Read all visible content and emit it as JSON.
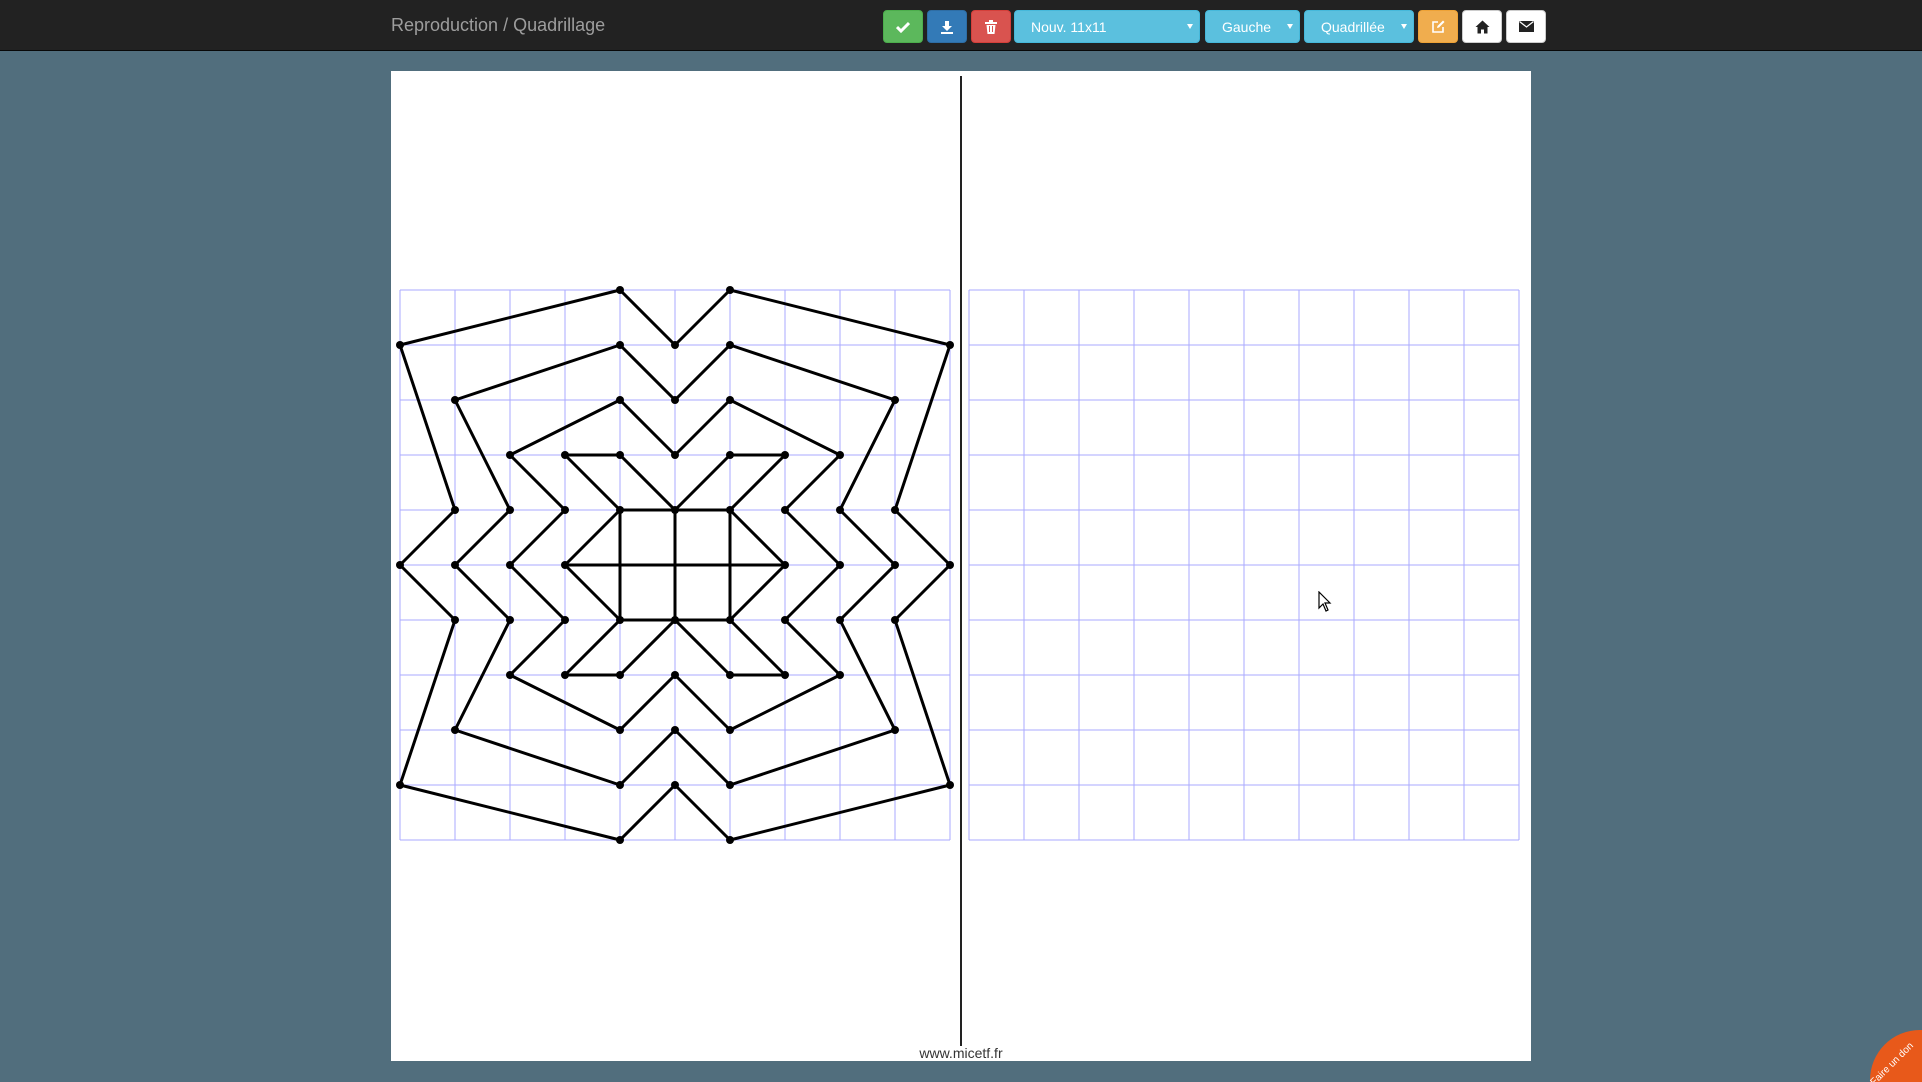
{
  "header": {
    "title": "Reproduction / Quadrillage",
    "buttons": {
      "validate_icon": "check-icon",
      "download_icon": "download-icon",
      "delete_icon": "trash-icon",
      "edit_icon": "edit-icon",
      "home_icon": "home-icon",
      "mail_icon": "envelope-icon"
    },
    "dropdowns": {
      "model": "Nouv. 11x11",
      "side": "Gauche",
      "paper": "Quadrillée"
    },
    "colors": {
      "green": "#5cb85c",
      "blue": "#337ab7",
      "red": "#d9534f",
      "info": "#5bc0de",
      "orange": "#f0ad4e",
      "white": "#ffffff"
    }
  },
  "workspace": {
    "grid_size": 11,
    "grid_color": "#aaaaff",
    "model_figure": {
      "segments": [
        [
          [
            0,
            1
          ],
          [
            4,
            0
          ]
        ],
        [
          [
            4,
            0
          ],
          [
            5,
            1
          ]
        ],
        [
          [
            5,
            1
          ],
          [
            6,
            0
          ]
        ],
        [
          [
            6,
            0
          ],
          [
            10,
            1
          ]
        ],
        [
          [
            0,
            1
          ],
          [
            1,
            4
          ]
        ],
        [
          [
            10,
            1
          ],
          [
            9,
            4
          ]
        ],
        [
          [
            1,
            4
          ],
          [
            0,
            5
          ]
        ],
        [
          [
            0,
            5
          ],
          [
            1,
            6
          ]
        ],
        [
          [
            9,
            4
          ],
          [
            10,
            5
          ]
        ],
        [
          [
            10,
            5
          ],
          [
            9,
            6
          ]
        ],
        [
          [
            1,
            6
          ],
          [
            0,
            9
          ]
        ],
        [
          [
            9,
            6
          ],
          [
            10,
            9
          ]
        ],
        [
          [
            0,
            9
          ],
          [
            4,
            10
          ]
        ],
        [
          [
            4,
            10
          ],
          [
            5,
            9
          ]
        ],
        [
          [
            5,
            9
          ],
          [
            6,
            10
          ]
        ],
        [
          [
            6,
            10
          ],
          [
            10,
            9
          ]
        ],
        [
          [
            1,
            2
          ],
          [
            4,
            1
          ]
        ],
        [
          [
            4,
            1
          ],
          [
            5,
            2
          ]
        ],
        [
          [
            5,
            2
          ],
          [
            6,
            1
          ]
        ],
        [
          [
            6,
            1
          ],
          [
            9,
            2
          ]
        ],
        [
          [
            1,
            2
          ],
          [
            2,
            4
          ]
        ],
        [
          [
            9,
            2
          ],
          [
            8,
            4
          ]
        ],
        [
          [
            2,
            4
          ],
          [
            1,
            5
          ]
        ],
        [
          [
            1,
            5
          ],
          [
            2,
            6
          ]
        ],
        [
          [
            8,
            4
          ],
          [
            9,
            5
          ]
        ],
        [
          [
            9,
            5
          ],
          [
            8,
            6
          ]
        ],
        [
          [
            2,
            6
          ],
          [
            1,
            8
          ]
        ],
        [
          [
            8,
            6
          ],
          [
            9,
            8
          ]
        ],
        [
          [
            1,
            8
          ],
          [
            4,
            9
          ]
        ],
        [
          [
            4,
            9
          ],
          [
            5,
            8
          ]
        ],
        [
          [
            5,
            8
          ],
          [
            6,
            9
          ]
        ],
        [
          [
            6,
            9
          ],
          [
            9,
            8
          ]
        ],
        [
          [
            2,
            3
          ],
          [
            4,
            2
          ]
        ],
        [
          [
            4,
            2
          ],
          [
            5,
            3
          ]
        ],
        [
          [
            5,
            3
          ],
          [
            6,
            2
          ]
        ],
        [
          [
            6,
            2
          ],
          [
            8,
            3
          ]
        ],
        [
          [
            2,
            3
          ],
          [
            3,
            4
          ]
        ],
        [
          [
            3,
            4
          ],
          [
            2,
            5
          ]
        ],
        [
          [
            2,
            5
          ],
          [
            3,
            6
          ]
        ],
        [
          [
            3,
            6
          ],
          [
            2,
            7
          ]
        ],
        [
          [
            8,
            3
          ],
          [
            7,
            4
          ]
        ],
        [
          [
            7,
            4
          ],
          [
            8,
            5
          ]
        ],
        [
          [
            8,
            5
          ],
          [
            7,
            6
          ]
        ],
        [
          [
            7,
            6
          ],
          [
            8,
            7
          ]
        ],
        [
          [
            2,
            7
          ],
          [
            4,
            8
          ]
        ],
        [
          [
            4,
            8
          ],
          [
            5,
            7
          ]
        ],
        [
          [
            5,
            7
          ],
          [
            6,
            8
          ]
        ],
        [
          [
            6,
            8
          ],
          [
            8,
            7
          ]
        ],
        [
          [
            3,
            3
          ],
          [
            4,
            3
          ]
        ],
        [
          [
            6,
            3
          ],
          [
            7,
            3
          ]
        ],
        [
          [
            3,
            7
          ],
          [
            4,
            7
          ]
        ],
        [
          [
            6,
            7
          ],
          [
            7,
            7
          ]
        ],
        [
          [
            3,
            3
          ],
          [
            4,
            4
          ]
        ],
        [
          [
            4,
            3
          ],
          [
            5,
            4
          ]
        ],
        [
          [
            5,
            4
          ],
          [
            6,
            3
          ]
        ],
        [
          [
            7,
            3
          ],
          [
            6,
            4
          ]
        ],
        [
          [
            3,
            7
          ],
          [
            4,
            6
          ]
        ],
        [
          [
            4,
            7
          ],
          [
            5,
            6
          ]
        ],
        [
          [
            5,
            6
          ],
          [
            6,
            7
          ]
        ],
        [
          [
            7,
            7
          ],
          [
            6,
            6
          ]
        ],
        [
          [
            3,
            5
          ],
          [
            4,
            4
          ]
        ],
        [
          [
            3,
            5
          ],
          [
            4,
            6
          ]
        ],
        [
          [
            7,
            5
          ],
          [
            6,
            4
          ]
        ],
        [
          [
            7,
            5
          ],
          [
            6,
            6
          ]
        ],
        [
          [
            3,
            5
          ],
          [
            7,
            5
          ]
        ],
        [
          [
            4,
            4
          ],
          [
            6,
            4
          ]
        ],
        [
          [
            4,
            6
          ],
          [
            6,
            6
          ]
        ],
        [
          [
            4,
            4
          ],
          [
            4,
            6
          ]
        ],
        [
          [
            5,
            4
          ],
          [
            5,
            6
          ]
        ],
        [
          [
            6,
            4
          ],
          [
            6,
            6
          ]
        ]
      ],
      "points": [
        [
          4,
          0
        ],
        [
          6,
          0
        ],
        [
          0,
          1
        ],
        [
          4,
          1
        ],
        [
          5,
          1
        ],
        [
          6,
          1
        ],
        [
          10,
          1
        ],
        [
          1,
          2
        ],
        [
          4,
          2
        ],
        [
          5,
          2
        ],
        [
          6,
          2
        ],
        [
          9,
          2
        ],
        [
          2,
          3
        ],
        [
          3,
          3
        ],
        [
          4,
          3
        ],
        [
          5,
          3
        ],
        [
          6,
          3
        ],
        [
          7,
          3
        ],
        [
          8,
          3
        ],
        [
          1,
          4
        ],
        [
          2,
          4
        ],
        [
          3,
          4
        ],
        [
          4,
          4
        ],
        [
          5,
          4
        ],
        [
          6,
          4
        ],
        [
          7,
          4
        ],
        [
          8,
          4
        ],
        [
          9,
          4
        ],
        [
          0,
          5
        ],
        [
          1,
          5
        ],
        [
          2,
          5
        ],
        [
          3,
          5
        ],
        [
          7,
          5
        ],
        [
          8,
          5
        ],
        [
          9,
          5
        ],
        [
          10,
          5
        ],
        [
          1,
          6
        ],
        [
          2,
          6
        ],
        [
          3,
          6
        ],
        [
          4,
          6
        ],
        [
          5,
          6
        ],
        [
          6,
          6
        ],
        [
          7,
          6
        ],
        [
          8,
          6
        ],
        [
          9,
          6
        ],
        [
          2,
          7
        ],
        [
          3,
          7
        ],
        [
          4,
          7
        ],
        [
          5,
          7
        ],
        [
          6,
          7
        ],
        [
          7,
          7
        ],
        [
          8,
          7
        ],
        [
          1,
          8
        ],
        [
          4,
          8
        ],
        [
          5,
          8
        ],
        [
          6,
          8
        ],
        [
          9,
          8
        ],
        [
          0,
          9
        ],
        [
          4,
          9
        ],
        [
          5,
          9
        ],
        [
          6,
          9
        ],
        [
          10,
          9
        ],
        [
          4,
          10
        ],
        [
          6,
          10
        ]
      ]
    }
  },
  "footer": {
    "site": "www.micetf.fr",
    "donate": "Faire un don",
    "donate_color": "#e8591a"
  }
}
